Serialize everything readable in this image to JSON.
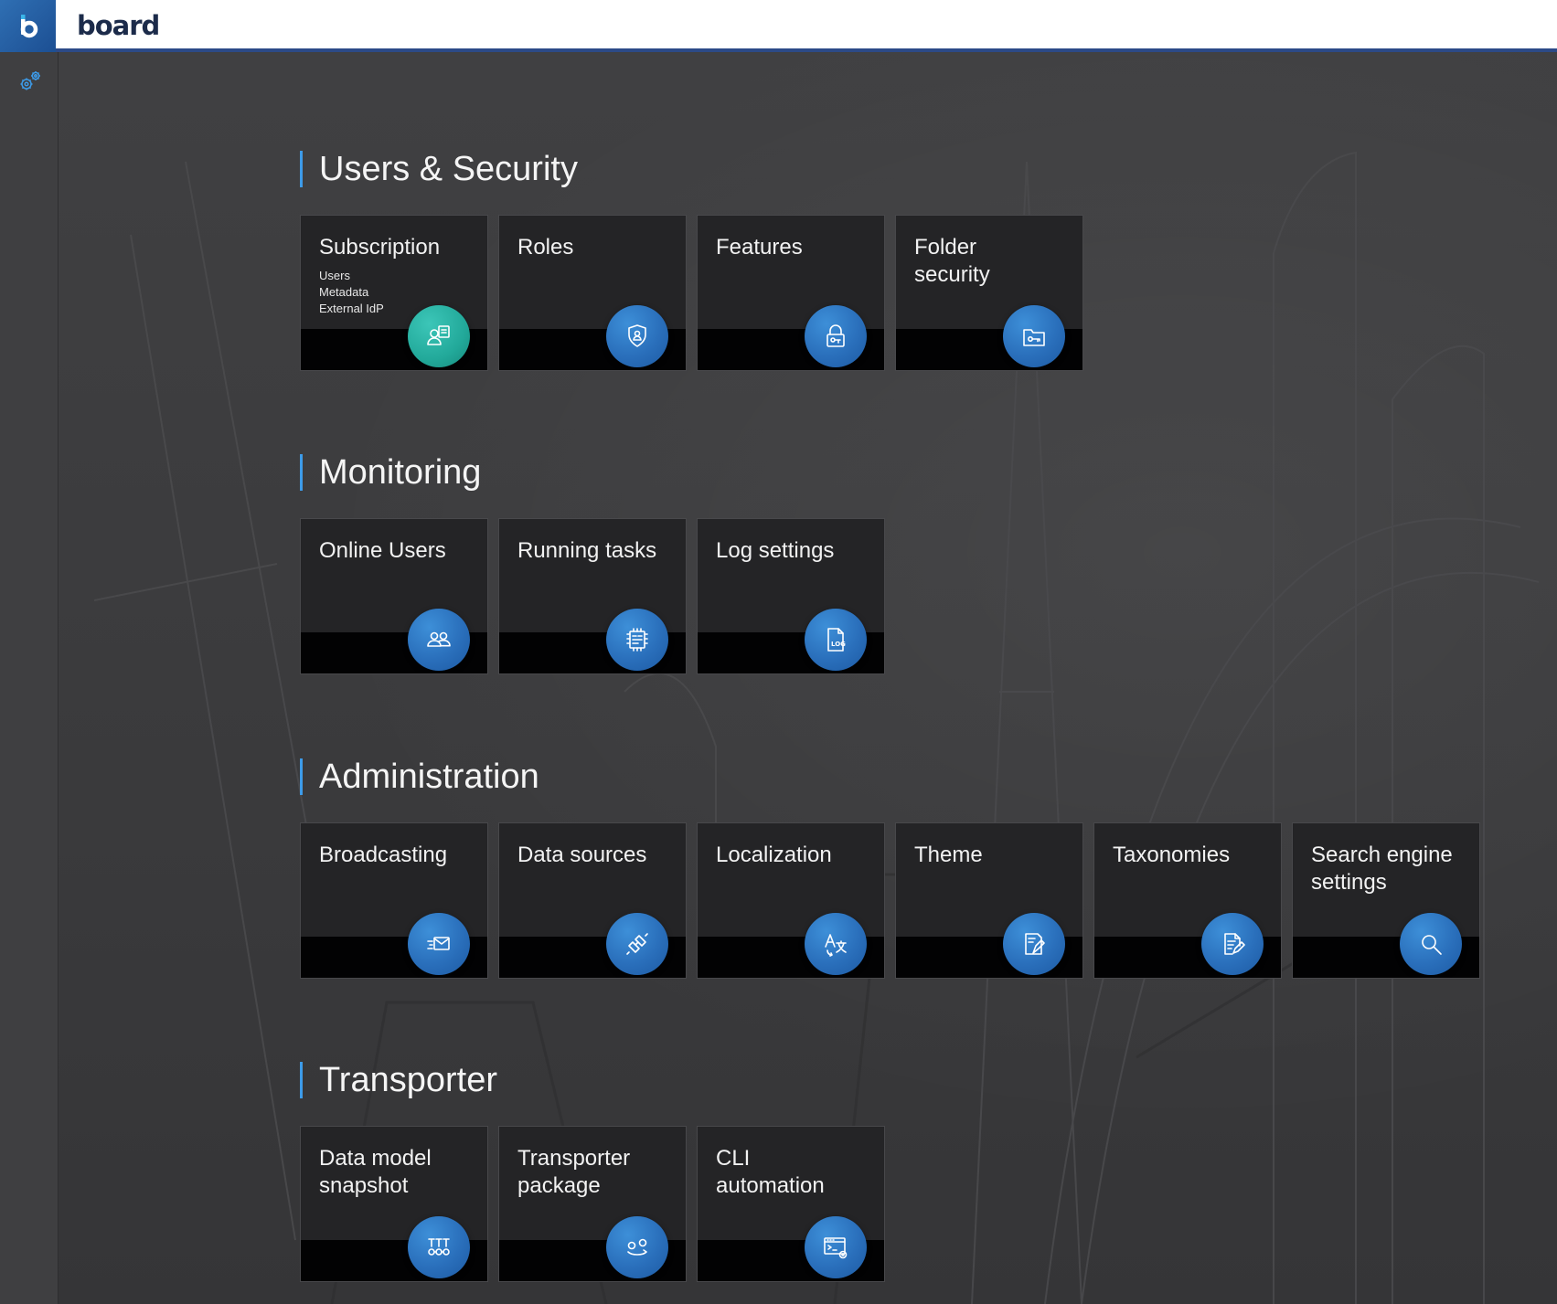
{
  "brand": {
    "letter": "b",
    "name": "board"
  },
  "colors": {
    "accent_blue": "#2a6fbb",
    "accent_teal": "#22a99a",
    "section_bar": "#3d9be9",
    "topbar_border": "#2c4a87"
  },
  "rail": {
    "settings_icon": "gears-icon"
  },
  "sections": [
    {
      "title": "Users & Security",
      "tiles": [
        {
          "title": "Subscription",
          "subs": [
            "Users",
            "Metadata",
            "External IdP"
          ],
          "icon": "user-card-icon",
          "teal": true
        },
        {
          "title": "Roles",
          "icon": "shield-user-icon"
        },
        {
          "title": "Features",
          "icon": "lock-key-icon"
        },
        {
          "title": "Folder\nsecurity",
          "icon": "folder-key-icon"
        }
      ]
    },
    {
      "title": "Monitoring",
      "tiles": [
        {
          "title": "Online Users",
          "icon": "users-group-icon"
        },
        {
          "title": "Running tasks",
          "icon": "task-chip-icon"
        },
        {
          "title": "Log settings",
          "icon": "log-file-icon"
        }
      ]
    },
    {
      "title": "Administration",
      "tiles": [
        {
          "title": "Broadcasting",
          "icon": "envelope-send-icon"
        },
        {
          "title": "Data sources",
          "icon": "plug-connection-icon"
        },
        {
          "title": "Localization",
          "icon": "translate-icon"
        },
        {
          "title": "Theme",
          "icon": "theme-palette-icon"
        },
        {
          "title": "Taxonomies",
          "icon": "document-edit-icon"
        },
        {
          "title": "Search engine\nsettings",
          "icon": "magnifier-icon"
        }
      ]
    },
    {
      "title": "Transporter",
      "tiles": [
        {
          "title": "Data model\nsnapshot",
          "icon": "snapshot-cubes-icon"
        },
        {
          "title": "Transporter\npackage",
          "icon": "package-transfer-icon"
        },
        {
          "title": "CLI\nautomation",
          "icon": "terminal-gear-icon"
        }
      ]
    }
  ]
}
